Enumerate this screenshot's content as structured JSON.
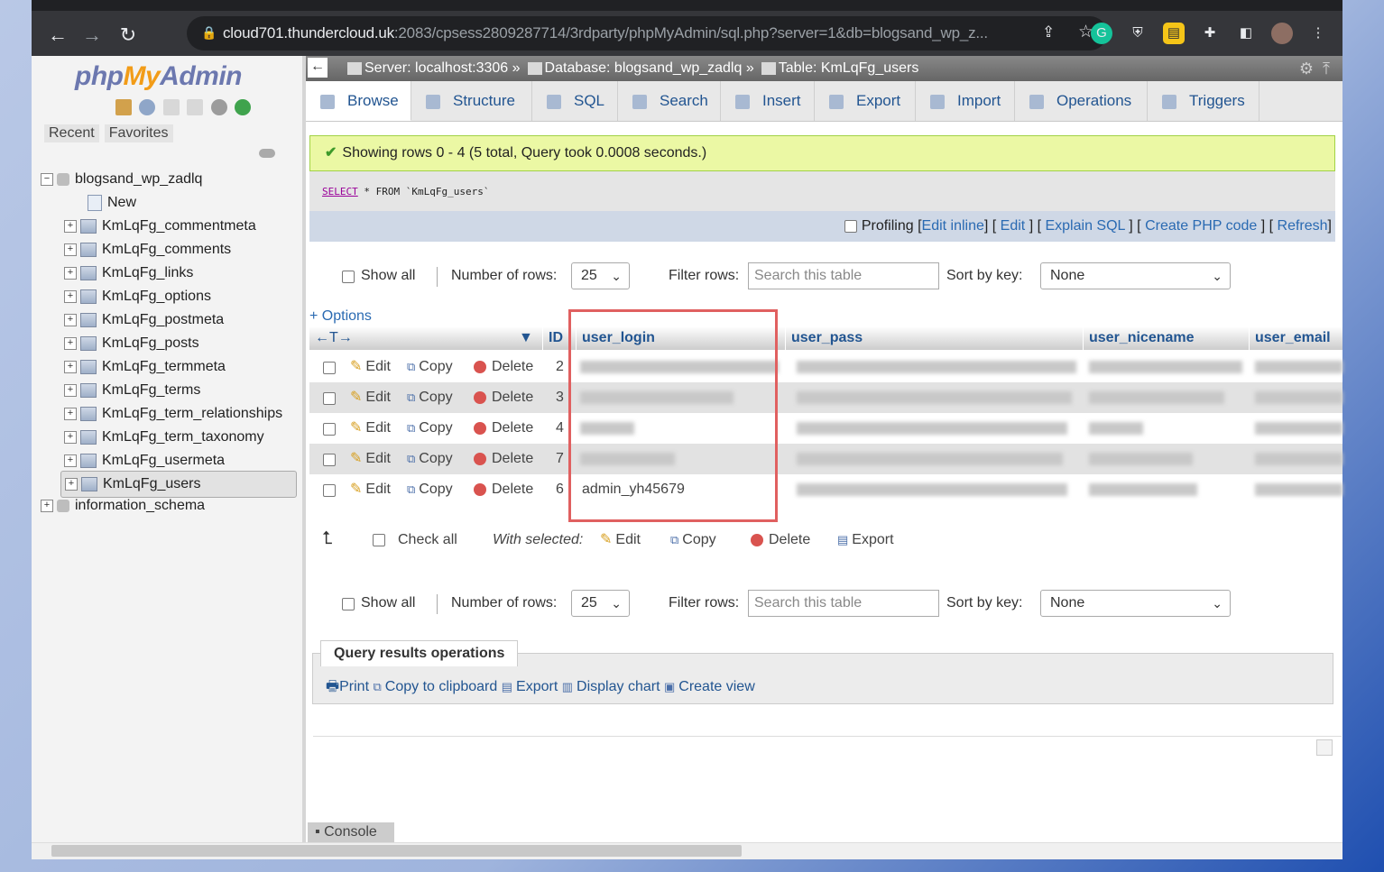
{
  "browser": {
    "url_host": "cloud701.thundercloud.uk",
    "url_rest": ":2083/cpsess2809287714/3rdparty/phpMyAdmin/sql.php?server=1&db=blogsand_wp_z..."
  },
  "sidebar": {
    "logo_php": "php",
    "logo_my": "My",
    "logo_admin": "Admin",
    "tabs": [
      "Recent",
      "Favorites"
    ],
    "database": "blogsand_wp_zadlq",
    "new_label": "New",
    "tables": [
      "KmLqFg_commentmeta",
      "KmLqFg_comments",
      "KmLqFg_links",
      "KmLqFg_options",
      "KmLqFg_postmeta",
      "KmLqFg_posts",
      "KmLqFg_termmeta",
      "KmLqFg_terms",
      "KmLqFg_term_relationships",
      "KmLqFg_term_taxonomy",
      "KmLqFg_usermeta",
      "KmLqFg_users"
    ],
    "other_db": "information_schema"
  },
  "breadcrumb": {
    "server": "Server: localhost:3306 »",
    "database": "Database: blogsand_wp_zadlq »",
    "table": "Table: KmLqFg_users"
  },
  "tabs": [
    "Browse",
    "Structure",
    "SQL",
    "Search",
    "Insert",
    "Export",
    "Import",
    "Operations",
    "Triggers"
  ],
  "result": {
    "message": "Showing rows 0 - 4 (5 total, Query took 0.0008 seconds.)",
    "sql_select": "SELECT",
    "sql_rest": " * FROM `KmLqFg_users`"
  },
  "profiling": {
    "label": "Profiling",
    "edit_inline": "Edit inline",
    "edit": "Edit",
    "explain": "Explain SQL",
    "php": "Create PHP code",
    "refresh": "Refresh"
  },
  "nav": {
    "show_all": "Show all",
    "rows_label": "Number of rows:",
    "rows_value": "25",
    "filter_label": "Filter rows:",
    "filter_placeholder": "Search this table",
    "sort_label": "Sort by key:",
    "sort_value": "None"
  },
  "options_link": "+ Options",
  "columns": [
    "ID",
    "user_login",
    "user_pass",
    "user_nicename",
    "user_email"
  ],
  "row_actions": {
    "edit": "Edit",
    "copy": "Copy",
    "delete": "Delete"
  },
  "rows": [
    {
      "id": "2",
      "login": ""
    },
    {
      "id": "3",
      "login": ""
    },
    {
      "id": "4",
      "login": ""
    },
    {
      "id": "7",
      "login": ""
    },
    {
      "id": "6",
      "login": "admin_yh45679"
    }
  ],
  "with_selected": {
    "check_all": "Check all",
    "label": "With selected:",
    "edit": "Edit",
    "copy": "Copy",
    "delete": "Delete",
    "export": "Export"
  },
  "query_ops": {
    "legend": "Query results operations",
    "print": "Print",
    "clipboard": "Copy to clipboard",
    "export": "Export",
    "chart": "Display chart",
    "view": "Create view"
  },
  "console_label": "Console"
}
